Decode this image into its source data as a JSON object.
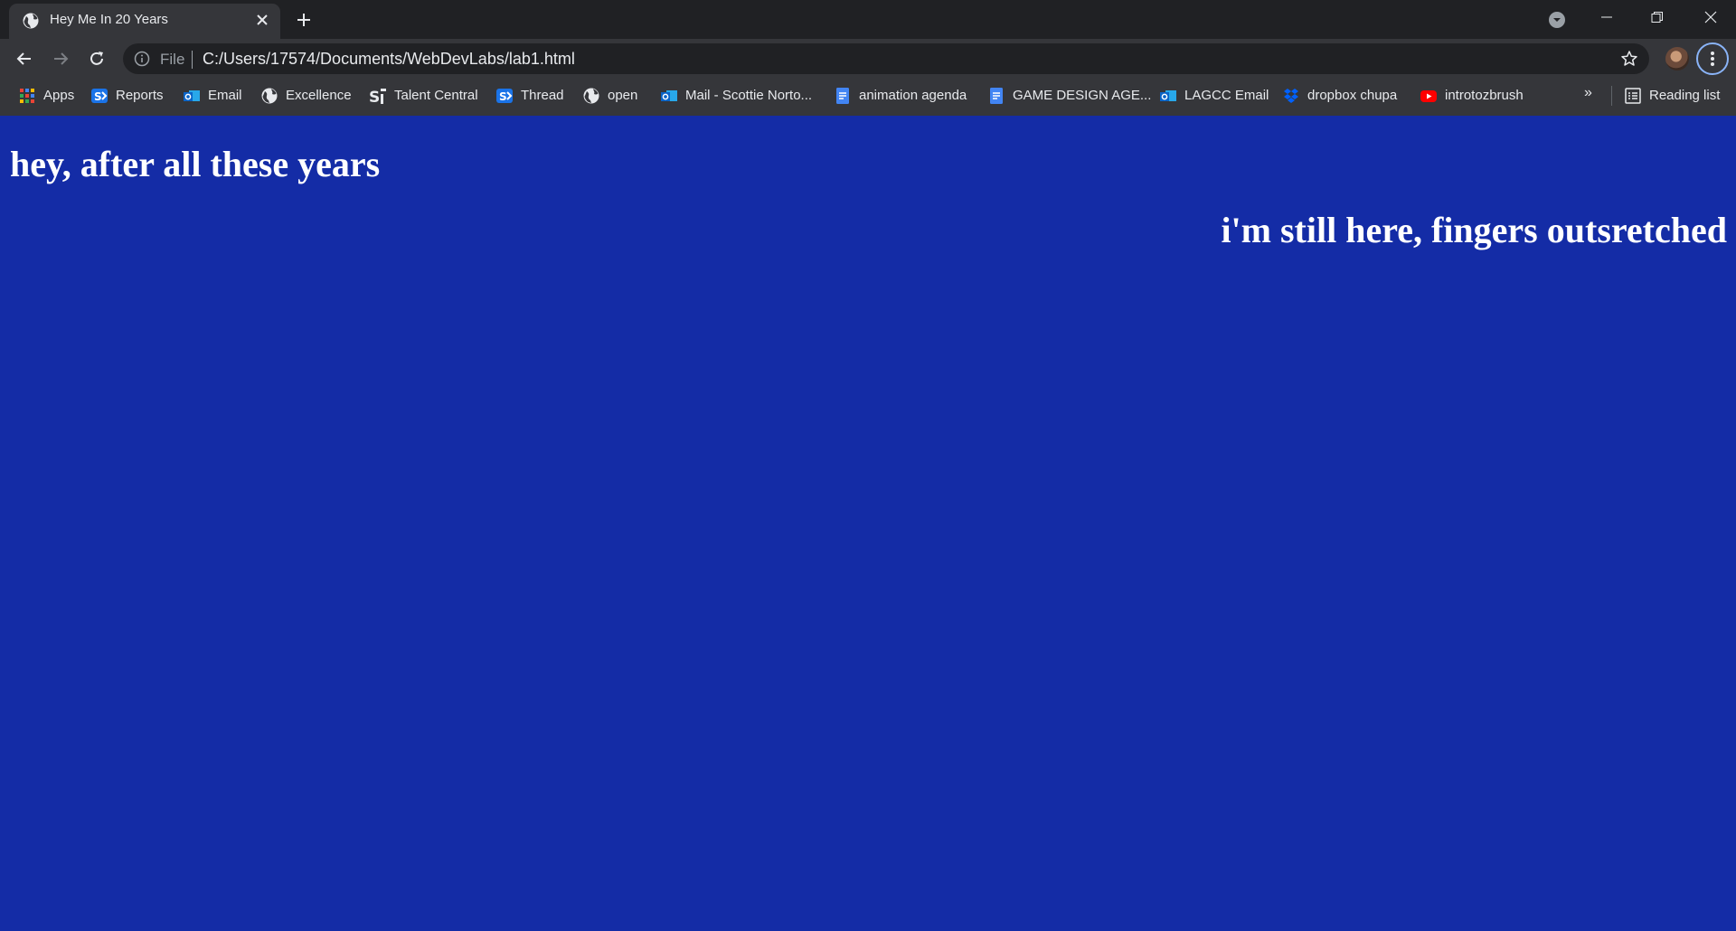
{
  "tab": {
    "title": "Hey Me In 20 Years"
  },
  "omnibox": {
    "scheme": "File",
    "url": "C:/Users/17574/Documents/WebDevLabs/lab1.html"
  },
  "bookmarks": {
    "items": [
      {
        "label": "Apps",
        "icon": "apps-grid-icon"
      },
      {
        "label": "Reports",
        "icon": "sharepoint-icon"
      },
      {
        "label": "Email",
        "icon": "outlook-icon"
      },
      {
        "label": "Excellence",
        "icon": "globe-icon"
      },
      {
        "label": "Talent Central",
        "icon": "sfi-icon"
      },
      {
        "label": "Thread",
        "icon": "sharepoint-icon"
      },
      {
        "label": "open",
        "icon": "globe-icon"
      },
      {
        "label": "Mail - Scottie Norto...",
        "icon": "outlook-icon"
      },
      {
        "label": "animation agenda",
        "icon": "docs-icon"
      },
      {
        "label": "GAME DESIGN AGE...",
        "icon": "docs-icon"
      },
      {
        "label": "LAGCC Email",
        "icon": "outlook-icon"
      },
      {
        "label": "dropbox chupa",
        "icon": "dropbox-icon"
      },
      {
        "label": "introtozbrush",
        "icon": "youtube-icon"
      }
    ],
    "more": "»",
    "reading_list": "Reading list"
  },
  "page": {
    "heading1": "hey, after all these years",
    "heading2": "i'm still here, fingers outsretched",
    "background": "#142ca6"
  }
}
